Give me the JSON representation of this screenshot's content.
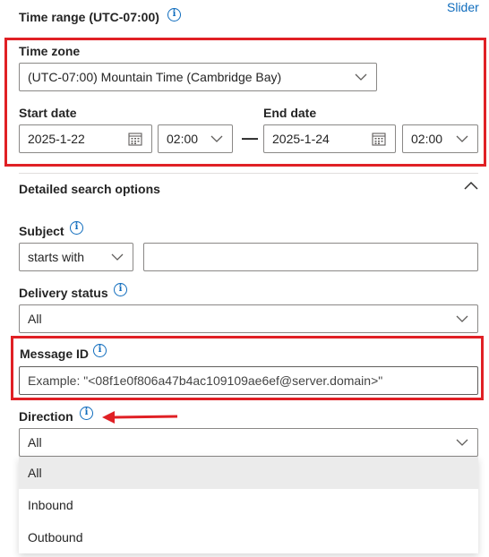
{
  "header": {
    "title": "Time range (UTC-07:00)",
    "slider_link": "Slider"
  },
  "time_zone": {
    "label": "Time zone",
    "value": "(UTC-07:00) Mountain Time (Cambridge Bay)"
  },
  "start_date": {
    "label": "Start date",
    "date": "2025-1-22",
    "time": "02:00"
  },
  "end_date": {
    "label": "End date",
    "date": "2025-1-24",
    "time": "02:00"
  },
  "range_separator": "—",
  "detailed": {
    "label": "Detailed search options"
  },
  "subject": {
    "label": "Subject",
    "operator": "starts with",
    "value": ""
  },
  "delivery_status": {
    "label": "Delivery status",
    "value": "All"
  },
  "message_id": {
    "label": "Message ID",
    "placeholder": "Example: \"<08f1e0f806a47b4ac109109ae6ef@server.domain>\""
  },
  "direction": {
    "label": "Direction",
    "value": "All",
    "options": [
      "All",
      "Inbound",
      "Outbound"
    ]
  },
  "colors": {
    "highlight": "#e02025",
    "accent": "#0f6cbd",
    "selected_option_bg": "#ebebeb"
  }
}
